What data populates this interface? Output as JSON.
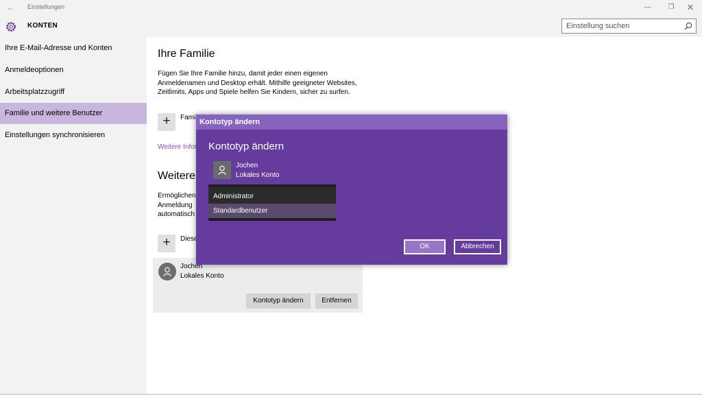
{
  "window": {
    "title": "Einstellungen"
  },
  "header": {
    "section": "KONTEN",
    "search_placeholder": "Einstellung suchen"
  },
  "sidebar": {
    "items": [
      {
        "label": "Ihre E-Mail-Adresse und Konten"
      },
      {
        "label": "Anmeldeoptionen"
      },
      {
        "label": "Arbeitsplatzzugriff"
      },
      {
        "label": "Familie und weitere Benutzer",
        "active": true
      },
      {
        "label": "Einstellungen synchronisieren"
      }
    ]
  },
  "main": {
    "family_heading": "Ihre Familie",
    "family_text_1": "Fügen Sie Ihre Familie hinzu, damit jeder einen eigenen",
    "family_text_2": "Anmeldenamen und Desktop erhält. Mithilfe geeigneter Websites,",
    "family_text_3": "Zeitlimits, Apps und Spiele helfen Sie Kindern, sicher zu surfen.",
    "add_family_label": "Famil",
    "more_info_link": "Weitere Infor",
    "others_heading": "Weitere",
    "others_text_1": "Ermöglichen",
    "others_text_2": "Anmeldung",
    "others_text_3": "automatisch",
    "add_other_label": "Diese",
    "user": {
      "name": "Jochen",
      "type": "Lokales Konto"
    },
    "change_type_button": "Kontotyp ändern",
    "remove_button": "Entfernen"
  },
  "dialog": {
    "titlebar": "Kontotyp ändern",
    "heading": "Kontotyp ändern",
    "user_name": "Jochen",
    "user_type": "Lokales Konto",
    "options": [
      "Administrator",
      "Standardbenutzer"
    ],
    "selected_option": "Standardbenutzer",
    "ok_button": "OK",
    "cancel_button": "Abbrechen"
  },
  "colors": {
    "accent": "#653c9e",
    "accent_light": "#8763c0",
    "nav_active": "#c9b6de",
    "link": "#7c4fb5"
  }
}
